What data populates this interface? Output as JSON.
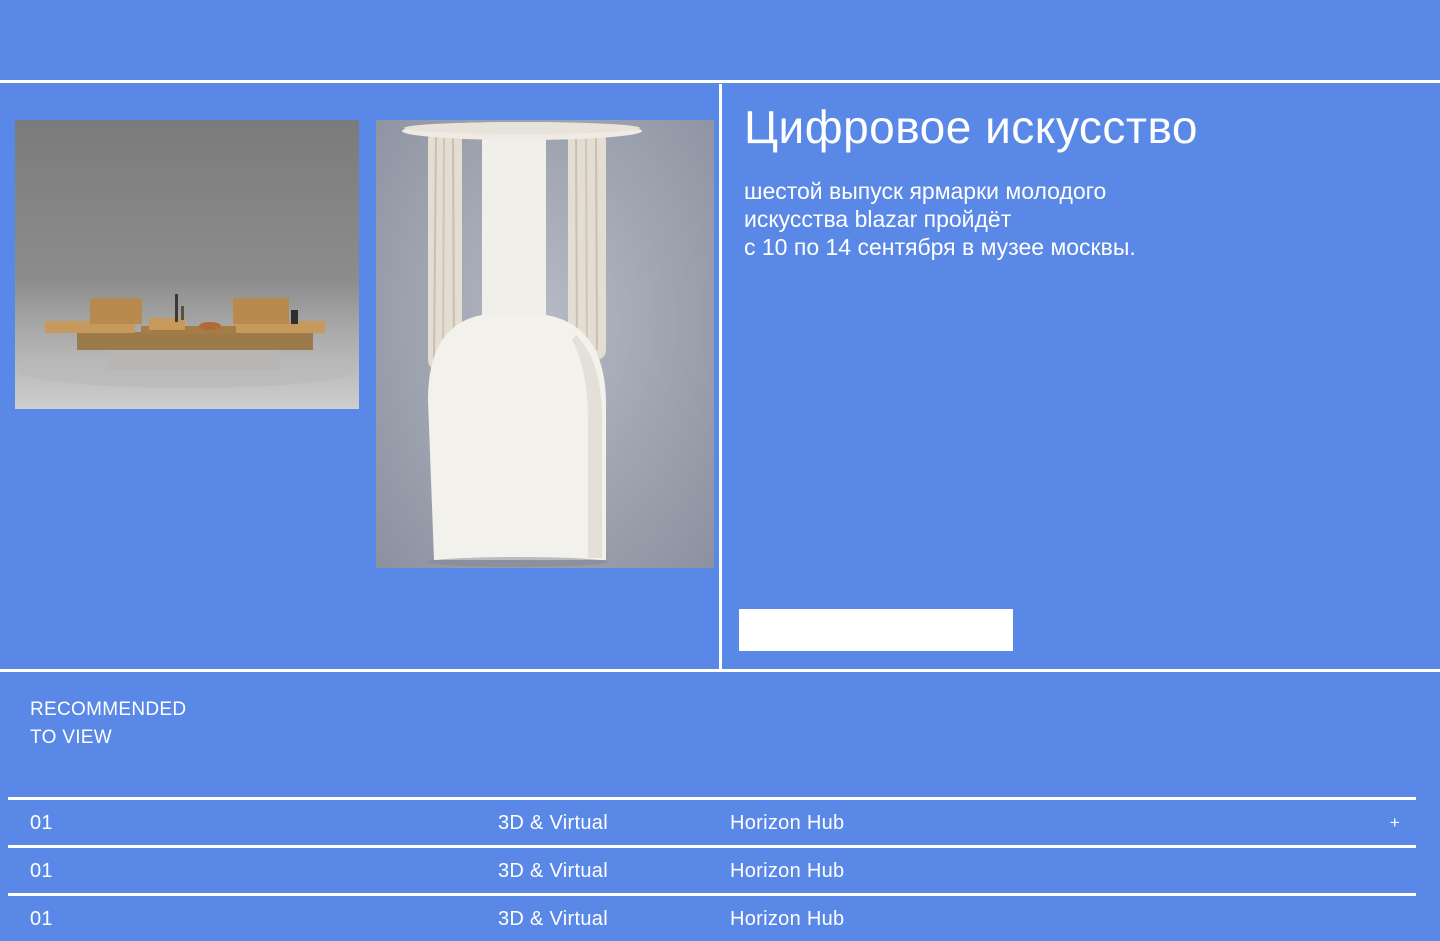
{
  "hero": {
    "title": "Цифровое искусство",
    "description_lines": [
      "шестой выпуск ярмарки молодого",
      "искусства blazar пройдёт",
      "с 10 по 14 сентября в музее москвы."
    ],
    "cta_label": ""
  },
  "gallery": {
    "images": [
      {
        "name": "table-artwork-photo"
      },
      {
        "name": "ceramic-vase-photo"
      }
    ]
  },
  "recommended": {
    "heading_lines": [
      "RECOMMENDED",
      "TO VIEW"
    ],
    "rows": [
      {
        "number": "01",
        "category": "3D & Virtual",
        "venue": "Horizon Hub",
        "action": "+"
      },
      {
        "number": "01",
        "category": "3D & Virtual",
        "venue": "Horizon Hub",
        "action": ""
      },
      {
        "number": "01",
        "category": "3D & Virtual",
        "venue": "Horizon Hub",
        "action": ""
      }
    ]
  },
  "colors": {
    "background": "#5a88e7",
    "foreground": "#ffffff"
  }
}
